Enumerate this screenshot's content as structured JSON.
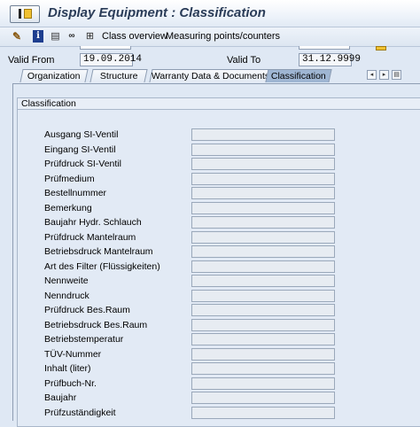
{
  "window": {
    "title": "Display Equipment : Classification"
  },
  "toolbar": {
    "icons": [
      "edit-icon",
      "info-icon",
      "document-icon",
      "binoculars-icon",
      "hierarchy-icon"
    ],
    "class_overview": "Class overview",
    "measuring_points": "Measuring points/counters"
  },
  "header": {
    "valid_from_label": "Valid From",
    "valid_from_value": "19.09.2014",
    "valid_to_label": "Valid To",
    "valid_to_value": "31.12.9999"
  },
  "tabs": [
    {
      "label": "Organization",
      "active": false
    },
    {
      "label": "Structure",
      "active": false
    },
    {
      "label": "Warranty Data & Documents",
      "active": false
    },
    {
      "label": "Classification",
      "active": true
    }
  ],
  "tab_nav": {
    "left": "◂",
    "right": "▸",
    "menu": "▤"
  },
  "classification": {
    "group_title": "Classification",
    "rows": [
      {
        "label": "Ausgang SI-Ventil",
        "value": ""
      },
      {
        "label": "Eingang SI-Ventil",
        "value": ""
      },
      {
        "label": "Prüfdruck SI-Ventil",
        "value": ""
      },
      {
        "label": "Prüfmedium",
        "value": ""
      },
      {
        "label": "Bestellnummer",
        "value": ""
      },
      {
        "label": "Bemerkung",
        "value": ""
      },
      {
        "label": "Baujahr Hydr. Schlauch",
        "value": ""
      },
      {
        "label": "Prüfdruck Mantelraum",
        "value": ""
      },
      {
        "label": "Betriebsdruck Mantelraum",
        "value": ""
      },
      {
        "label": "Art des Filter (Flüssigkeiten)",
        "value": ""
      },
      {
        "label": "Nennweite",
        "value": ""
      },
      {
        "label": "Nenndruck",
        "value": ""
      },
      {
        "label": "Prüfdruck Bes.Raum",
        "value": ""
      },
      {
        "label": "Betriebsdruck Bes.Raum",
        "value": ""
      },
      {
        "label": "Betriebstemperatur",
        "value": ""
      },
      {
        "label": "TÜV-Nummer",
        "value": ""
      },
      {
        "label": "Inhalt (liter)",
        "value": ""
      },
      {
        "label": "Prüfbuch-Nr.",
        "value": ""
      },
      {
        "label": "Baujahr",
        "value": ""
      },
      {
        "label": "Prüfzuständigkeit",
        "value": ""
      }
    ]
  },
  "colors": {
    "accent": "#9fb6d3",
    "background": "#dfe8f4",
    "title": "#2a3c58"
  }
}
